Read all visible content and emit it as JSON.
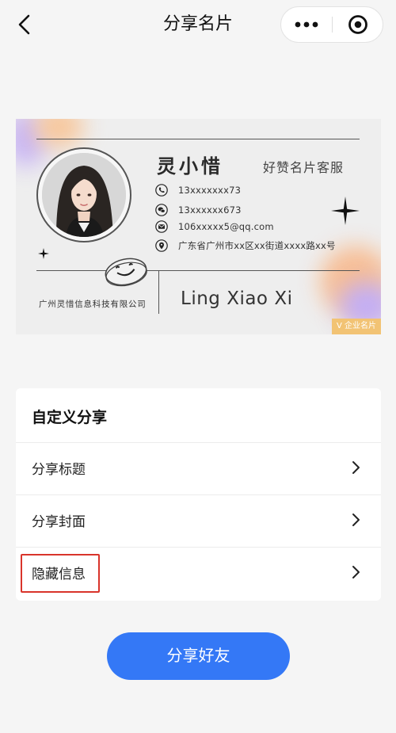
{
  "nav": {
    "title": "分享名片",
    "back_icon": "chevron-left-icon",
    "more_icon": "more-dots-icon",
    "close_icon": "target-close-icon"
  },
  "card": {
    "name": "灵小惜",
    "role": "好赞名片客服",
    "phone": "13xxxxxxx73",
    "wechat": "13xxxxxx673",
    "email": "106xxxxx5@qq.com",
    "address": "广东省广州市xx区xx街道xxxx路xx号",
    "company": "广州灵惜信息科技有限公司",
    "english_name": "Ling Xiao Xi",
    "badge": "V 企业名片"
  },
  "custom_share": {
    "heading": "自定义分享",
    "items": [
      {
        "label": "分享标题"
      },
      {
        "label": "分享封面"
      },
      {
        "label": "隐藏信息",
        "highlighted": true
      }
    ]
  },
  "share_button": {
    "label": "分享好友"
  },
  "colors": {
    "accent": "#3478f6",
    "highlight": "#d9342b",
    "badge": "#f2c374"
  }
}
